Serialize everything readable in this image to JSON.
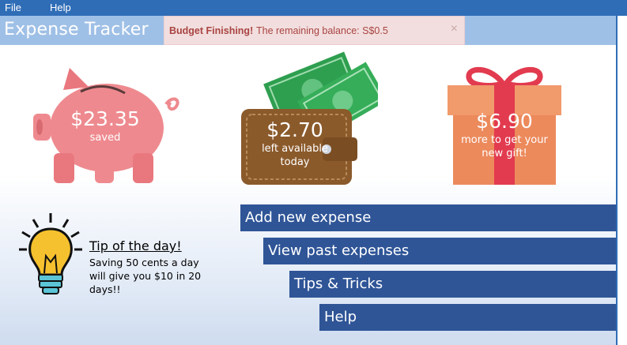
{
  "menu": {
    "file_label": "File",
    "help_label": "Help"
  },
  "app": {
    "title": "Expense Tracker"
  },
  "alert": {
    "title": "Budget Finishing!",
    "message": "The remaining balance: S$0.5",
    "close": "×"
  },
  "stats": {
    "saved": {
      "amount": "$23.35",
      "caption": "saved",
      "icon": "piggy-bank-icon"
    },
    "available": {
      "amount": "$2.70",
      "caption": "left available today",
      "icon": "wallet-icon"
    },
    "gift": {
      "amount": "$6.90",
      "caption": "more to get your new gift!",
      "icon": "gift-box-icon"
    }
  },
  "tip": {
    "title": "Tip of the day!",
    "text": "Saving 50 cents a day will give you $10 in 20 days!!",
    "icon": "lightbulb-icon"
  },
  "nav": {
    "add_expense": "Add new expense",
    "view_expenses": "View past expenses",
    "tips_tricks": "Tips & Tricks",
    "help": "Help"
  },
  "colors": {
    "menu_bar": "#2f6db7",
    "title_bar": "#9fc0e6",
    "alert_bg": "#f2dede",
    "alert_text": "#a94442",
    "nav_button": "#2f5597",
    "pig": "#ee8a8f",
    "wallet": "#8b5a2b",
    "money": "#2e9e4f",
    "gift_box": "#ee9263",
    "gift_ribbon": "#e23b4f",
    "bulb": "#f6c12e"
  }
}
